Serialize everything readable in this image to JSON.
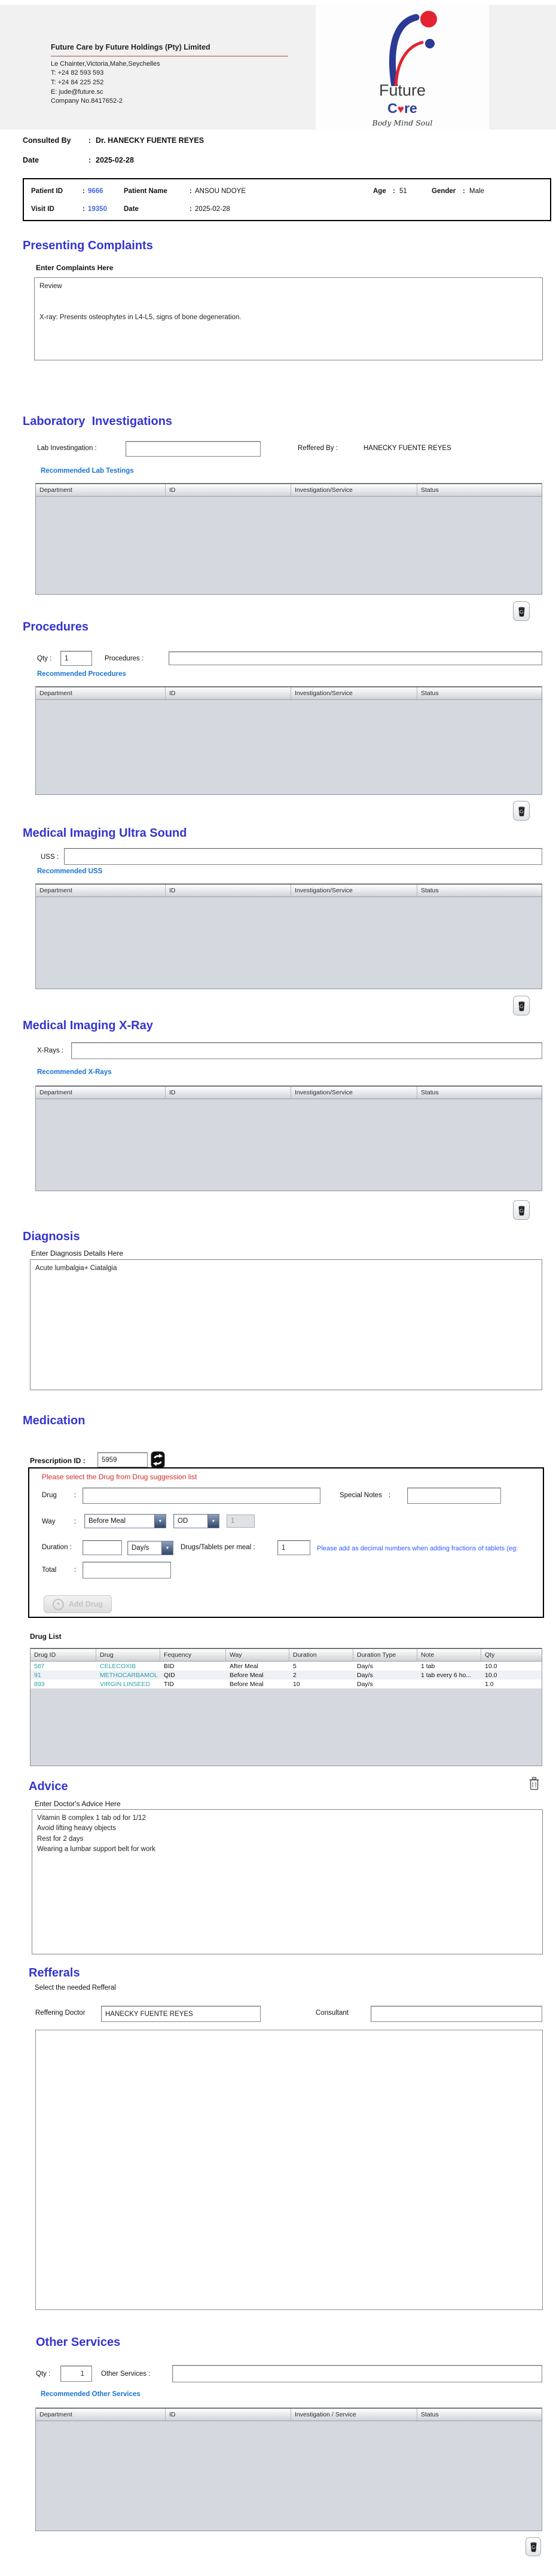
{
  "ui": {
    "colon": ":",
    "dropdown_arrow": "▼",
    "plus": "+"
  },
  "header": {
    "company_title": "Future Care by Future Holdings (Pty) Limited",
    "address": "Le Chainter,Victoria,Mahe,Seychelles",
    "phone1": "T: +24  82 593 593",
    "phone2": "T: +24  84 225 252",
    "email": "E: jude@future.sc",
    "company_no": "Company No.8417652-2",
    "logo": {
      "future": "Future",
      "care_c": "C",
      "care_heart": "♥",
      "care_re": "re",
      "tagline": "Body Mind Soul"
    }
  },
  "consultation": {
    "consulted_by_label": "Consulted By",
    "consulted_by_value": "Dr.  HANECKY FUENTE REYES",
    "date_label": "Date",
    "date_value": "2025-02-28"
  },
  "patient_bar": {
    "patient_id_label": "Patient ID",
    "patient_id": "9666",
    "patient_name_label": "Patient Name",
    "patient_name": "ANSOU NDOYE",
    "age_label": "Age",
    "age": "51",
    "gender_label": "Gender",
    "gender": "Male",
    "visit_id_label": "Visit ID",
    "visit_id": "19350",
    "date_label": "Date",
    "date": "2025-02-28"
  },
  "presenting_complaints": {
    "title": "Presenting Complaints",
    "label": "Enter Complaints Here",
    "text": "Review\n\n\nX-ray: Presents osteophytes in L4-L5, signs of bone degeneration."
  },
  "laboratory": {
    "title": "Laboratory  Investigations",
    "lab_label": "Lab Investingation :",
    "referred_by_label": "Reffered By :",
    "referred_by": "HANECKY FUENTE REYES",
    "recommended_label": "Recommended Lab Testings",
    "table_headers": [
      "Department",
      "ID",
      "Investigation/Service",
      "Status"
    ]
  },
  "procedures": {
    "title": "Procedures",
    "qty_label": "Qty :",
    "qty_value": "1",
    "procedures_label": "Procedures :",
    "recommended_label": "Recommended Procedures",
    "table_headers": [
      "Department",
      "ID",
      "Investigation/Service",
      "Status"
    ]
  },
  "ultrasound": {
    "title": "Medical Imaging Ultra Sound",
    "uss_label": "USS :",
    "recommended_label": "Recommended USS",
    "table_headers": [
      "Department",
      "ID",
      "Investigation/Service",
      "Status"
    ]
  },
  "xray": {
    "title": "Medical Imaging X-Ray",
    "xray_label": "X-Rays :",
    "recommended_label": "Recommended X-Rays",
    "table_headers": [
      "Department",
      "ID",
      "Investigation/Service",
      "Status"
    ]
  },
  "diagnosis": {
    "title": "Diagnosis",
    "label": "Enter Diagnosis Details Here",
    "text": "Acute lumbalgia+ Ciatalgia"
  },
  "medication": {
    "title": "Medication",
    "prescription_id_label": "Prescription ID :",
    "prescription_id": "5959",
    "panel": {
      "hint": "Please select the Drug from Drug suggession list",
      "drug_label": "Drug",
      "special_notes_label": "Special Notes",
      "way_label": "Way",
      "way_value": "Before Meal",
      "frequency_value": "OD",
      "times_value": "1",
      "duration_label": "Duration :",
      "duration_unit": "Day/s",
      "per_meal_label": "Drugs/Tablets per meal :",
      "per_meal_value": "1",
      "fraction_note": "Please add as decimal numbers when adding fractions of tablets (eg:",
      "total_label": "Total",
      "add_drug_label": "Add Drug"
    },
    "drug_list": {
      "label": "Drug List",
      "headers": [
        "Drug ID",
        "Drug",
        "Fequency",
        "Way",
        "Duration",
        "Duration Type",
        "Note",
        "Qty"
      ],
      "rows": [
        {
          "drug_id": "587",
          "drug": "CELECOXIB",
          "frequency": "BID",
          "way": "After Meal",
          "duration": "5",
          "duration_type": "Day/s",
          "note": "1 tab",
          "qty": "10.0"
        },
        {
          "drug_id": "91",
          "drug": "METHOCARBAMOL",
          "frequency": "QID",
          "way": "Before Meal",
          "duration": "2",
          "duration_type": "Day/s",
          "note": "1 tab every 6 ho...",
          "qty": "10.0"
        },
        {
          "drug_id": "893",
          "drug": "VIRGIN LINSEED",
          "frequency": "TID",
          "way": "Before Meal",
          "duration": "10",
          "duration_type": "Day/s",
          "note": "",
          "qty": "1.0"
        }
      ]
    }
  },
  "advice": {
    "title": "Advice",
    "label": "Enter Doctor's Advice Here",
    "text": "Vitamin B complex 1 tab od for 1/12\nAvoid lifting heavy objects\nRest for 2 days\nWearing a lumbar support belt for work"
  },
  "referrals": {
    "title": "Refferals",
    "subtitle": "Select the needed Refferal",
    "referring_doctor_label": "Reffering Doctor",
    "referring_doctor": "HANECKY FUENTE REYES",
    "consultant_label": "Consultant"
  },
  "other_services": {
    "title": "Other Services",
    "qty_label": "Qty :",
    "qty_value": "1",
    "services_label": "Other Services :",
    "recommended_label": "Recommended Other Services",
    "table_headers": [
      "Department",
      "ID",
      "Investigation / Service",
      "Status"
    ]
  },
  "colors": {
    "section_heading": "#3434cf",
    "recommended_link": "#1874d2",
    "id_value_blue": "#4169e1",
    "drug_teal": "#2aa2a6",
    "hint_red": "#d42a2a",
    "note_blue": "#2e5bff",
    "table_body": "#d4d9df"
  }
}
